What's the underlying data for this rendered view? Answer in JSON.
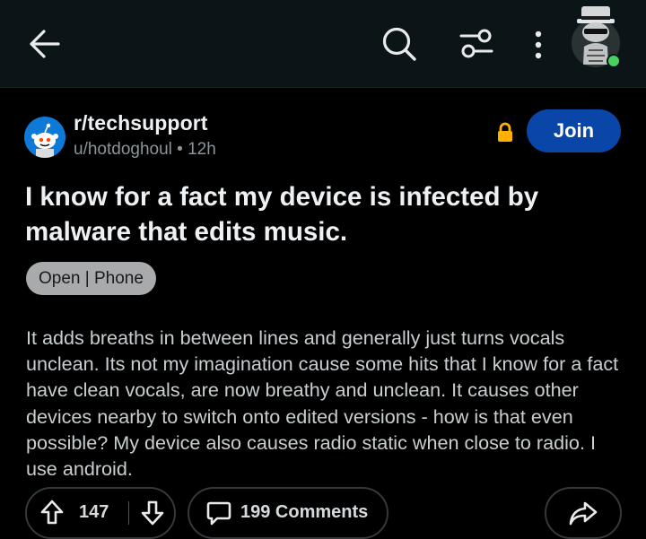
{
  "header": {
    "back_icon": "arrow-left-icon",
    "search_icon": "search-icon",
    "filter_icon": "sliders-icon",
    "more_icon": "vertical-dots-icon",
    "avatar_icon": "user-avatar-icon",
    "online_color": "#46d160"
  },
  "post": {
    "subreddit": "r/techsupport",
    "author_line": "u/hotdoghoul • 12h",
    "lock_icon": "lock-icon",
    "lock_color": "#ffb000",
    "join_label": "Join",
    "join_color": "#0a45a8",
    "title": "I know for a fact my device is infected by malware that edits music.",
    "flair": "Open | Phone",
    "body": "It adds breaths in between lines and generally just turns vocals unclean. Its not my imagination cause some hits that I know for a fact have clean vocals, are now breathy and unclean. It causes other devices nearby to switch onto edited versions - how is that even possible? My device also causes radio static when close to radio. I use android."
  },
  "actions": {
    "upvote_icon": "upvote-arrow-icon",
    "downvote_icon": "downvote-arrow-icon",
    "score": "147",
    "comment_icon": "comment-bubble-icon",
    "comments_label": "199 Comments",
    "share_icon": "share-arrow-icon"
  }
}
